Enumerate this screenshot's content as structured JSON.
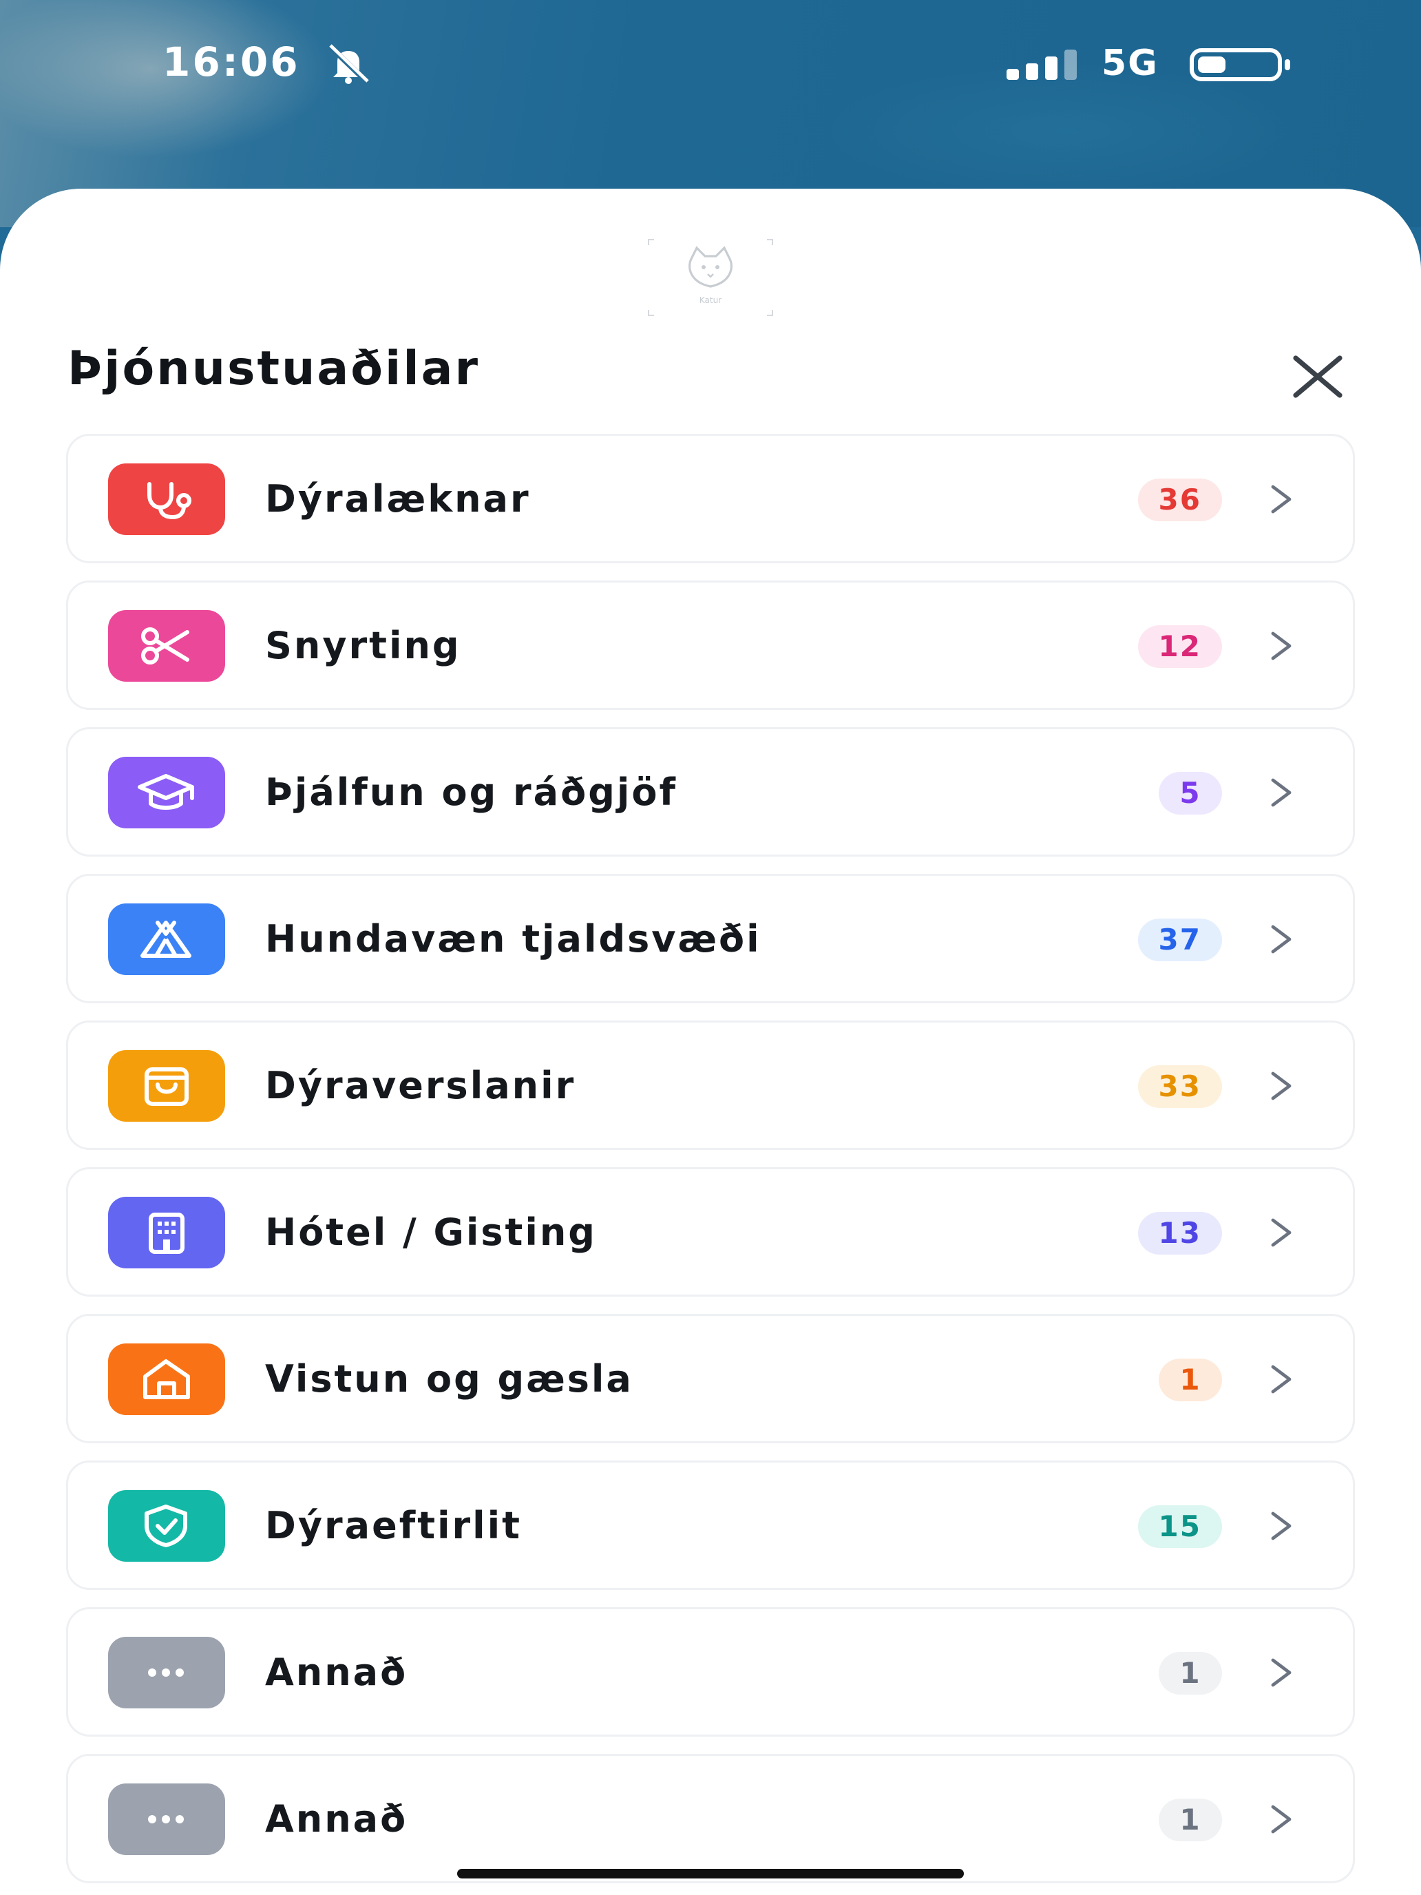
{
  "status_bar": {
    "time": "16:06",
    "network": "5G",
    "icons": [
      "bell-off-icon",
      "signal-icon",
      "battery-icon"
    ]
  },
  "sheet": {
    "logo_text": "Katur",
    "title": "Þjónustuaðilar",
    "close_icon": "close-icon"
  },
  "categories": [
    {
      "label": "Dýralæknar",
      "count": "36",
      "icon": "stethoscope-icon",
      "color": "#ef4444",
      "badge_bg": "#fde7e7",
      "badge_fg": "#e53935"
    },
    {
      "label": "Snyrting",
      "count": "12",
      "icon": "scissors-icon",
      "color": "#ec4899",
      "badge_bg": "#fde6f1",
      "badge_fg": "#db2777"
    },
    {
      "label": "Þjálfun og ráðgjöf",
      "count": "5",
      "icon": "graduation-cap-icon",
      "color": "#8b5cf6",
      "badge_bg": "#eee8fe",
      "badge_fg": "#7c3aed"
    },
    {
      "label": "Hundavæn tjaldsvæði",
      "count": "37",
      "icon": "tent-icon",
      "color": "#3b82f6",
      "badge_bg": "#e4effe",
      "badge_fg": "#2563eb"
    },
    {
      "label": "Dýraverslanir",
      "count": "33",
      "icon": "shopping-bag-icon",
      "color": "#f59e0b",
      "badge_bg": "#fef1dc",
      "badge_fg": "#e69100"
    },
    {
      "label": "Hótel / Gisting",
      "count": "13",
      "icon": "building-icon",
      "color": "#6366f1",
      "badge_bg": "#e8e9fd",
      "badge_fg": "#4f46e5"
    },
    {
      "label": "Vistun og gæsla",
      "count": "1",
      "icon": "home-icon",
      "color": "#f97316",
      "badge_bg": "#feeadb",
      "badge_fg": "#ea580c"
    },
    {
      "label": "Dýraeftirlit",
      "count": "15",
      "icon": "shield-check-icon",
      "color": "#14b8a6",
      "badge_bg": "#dcf6f1",
      "badge_fg": "#0d9488"
    },
    {
      "label": "Annað",
      "count": "1",
      "icon": "more-dots-icon",
      "color": "#9ca3af",
      "badge_bg": "#f1f2f4",
      "badge_fg": "#6b7280"
    },
    {
      "label": "Annað",
      "count": "1",
      "icon": "more-dots-icon",
      "color": "#9ca3af",
      "badge_bg": "#f1f2f4",
      "badge_fg": "#6b7280"
    }
  ]
}
